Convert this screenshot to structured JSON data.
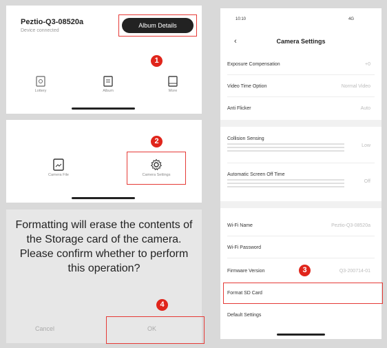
{
  "panel1": {
    "device_name": "Peztio-Q3-08520a",
    "device_status": "Device connected",
    "action_button": "Album Details",
    "icons": [
      {
        "label": "Lottery",
        "icon": "camera-icon"
      },
      {
        "label": "Album",
        "icon": "album-icon"
      },
      {
        "label": "More",
        "icon": "more-icon"
      }
    ],
    "step": "1"
  },
  "panel2": {
    "camera_file_label": "Camera File",
    "camera_settings_label": "Camera Settings",
    "step": "2"
  },
  "panel3": {
    "message": "Formatting will erase the contents of the Storage card of the camera. Please confirm whether to perform this operation?",
    "cancel_label": "Cancel",
    "ok_label": "OK",
    "step": "4"
  },
  "panel4": {
    "time": "10:10",
    "signal": "4G",
    "title": "Camera Settings",
    "rows": {
      "exposure": {
        "label": "Exposure Compensation",
        "value": "+0"
      },
      "video_time": {
        "label": "Video Time Option",
        "value": "Normal Video"
      },
      "anti_flicker": {
        "label": "Anti Flicker",
        "value": "Auto"
      },
      "collision": {
        "label": "Collision Sensing",
        "value": "Low"
      },
      "screen_off": {
        "label": "Automatic Screen Off Time",
        "value": "Off"
      },
      "wifi_name": {
        "label": "Wi-Fi Name",
        "value": "Peztio-Q3-08520a"
      },
      "wifi_password": {
        "label": "Wi-Fi Password",
        "value": ""
      },
      "firmware": {
        "label": "Firmware Version",
        "value": "Q3-200714-01"
      },
      "format_sd": {
        "label": "Format SD Card",
        "value": ""
      },
      "default": {
        "label": "Default Settings",
        "value": ""
      }
    },
    "step": "3"
  },
  "colors": {
    "accent_red": "#e0251b",
    "frame_red": "#e53935",
    "dark": "#222222"
  }
}
